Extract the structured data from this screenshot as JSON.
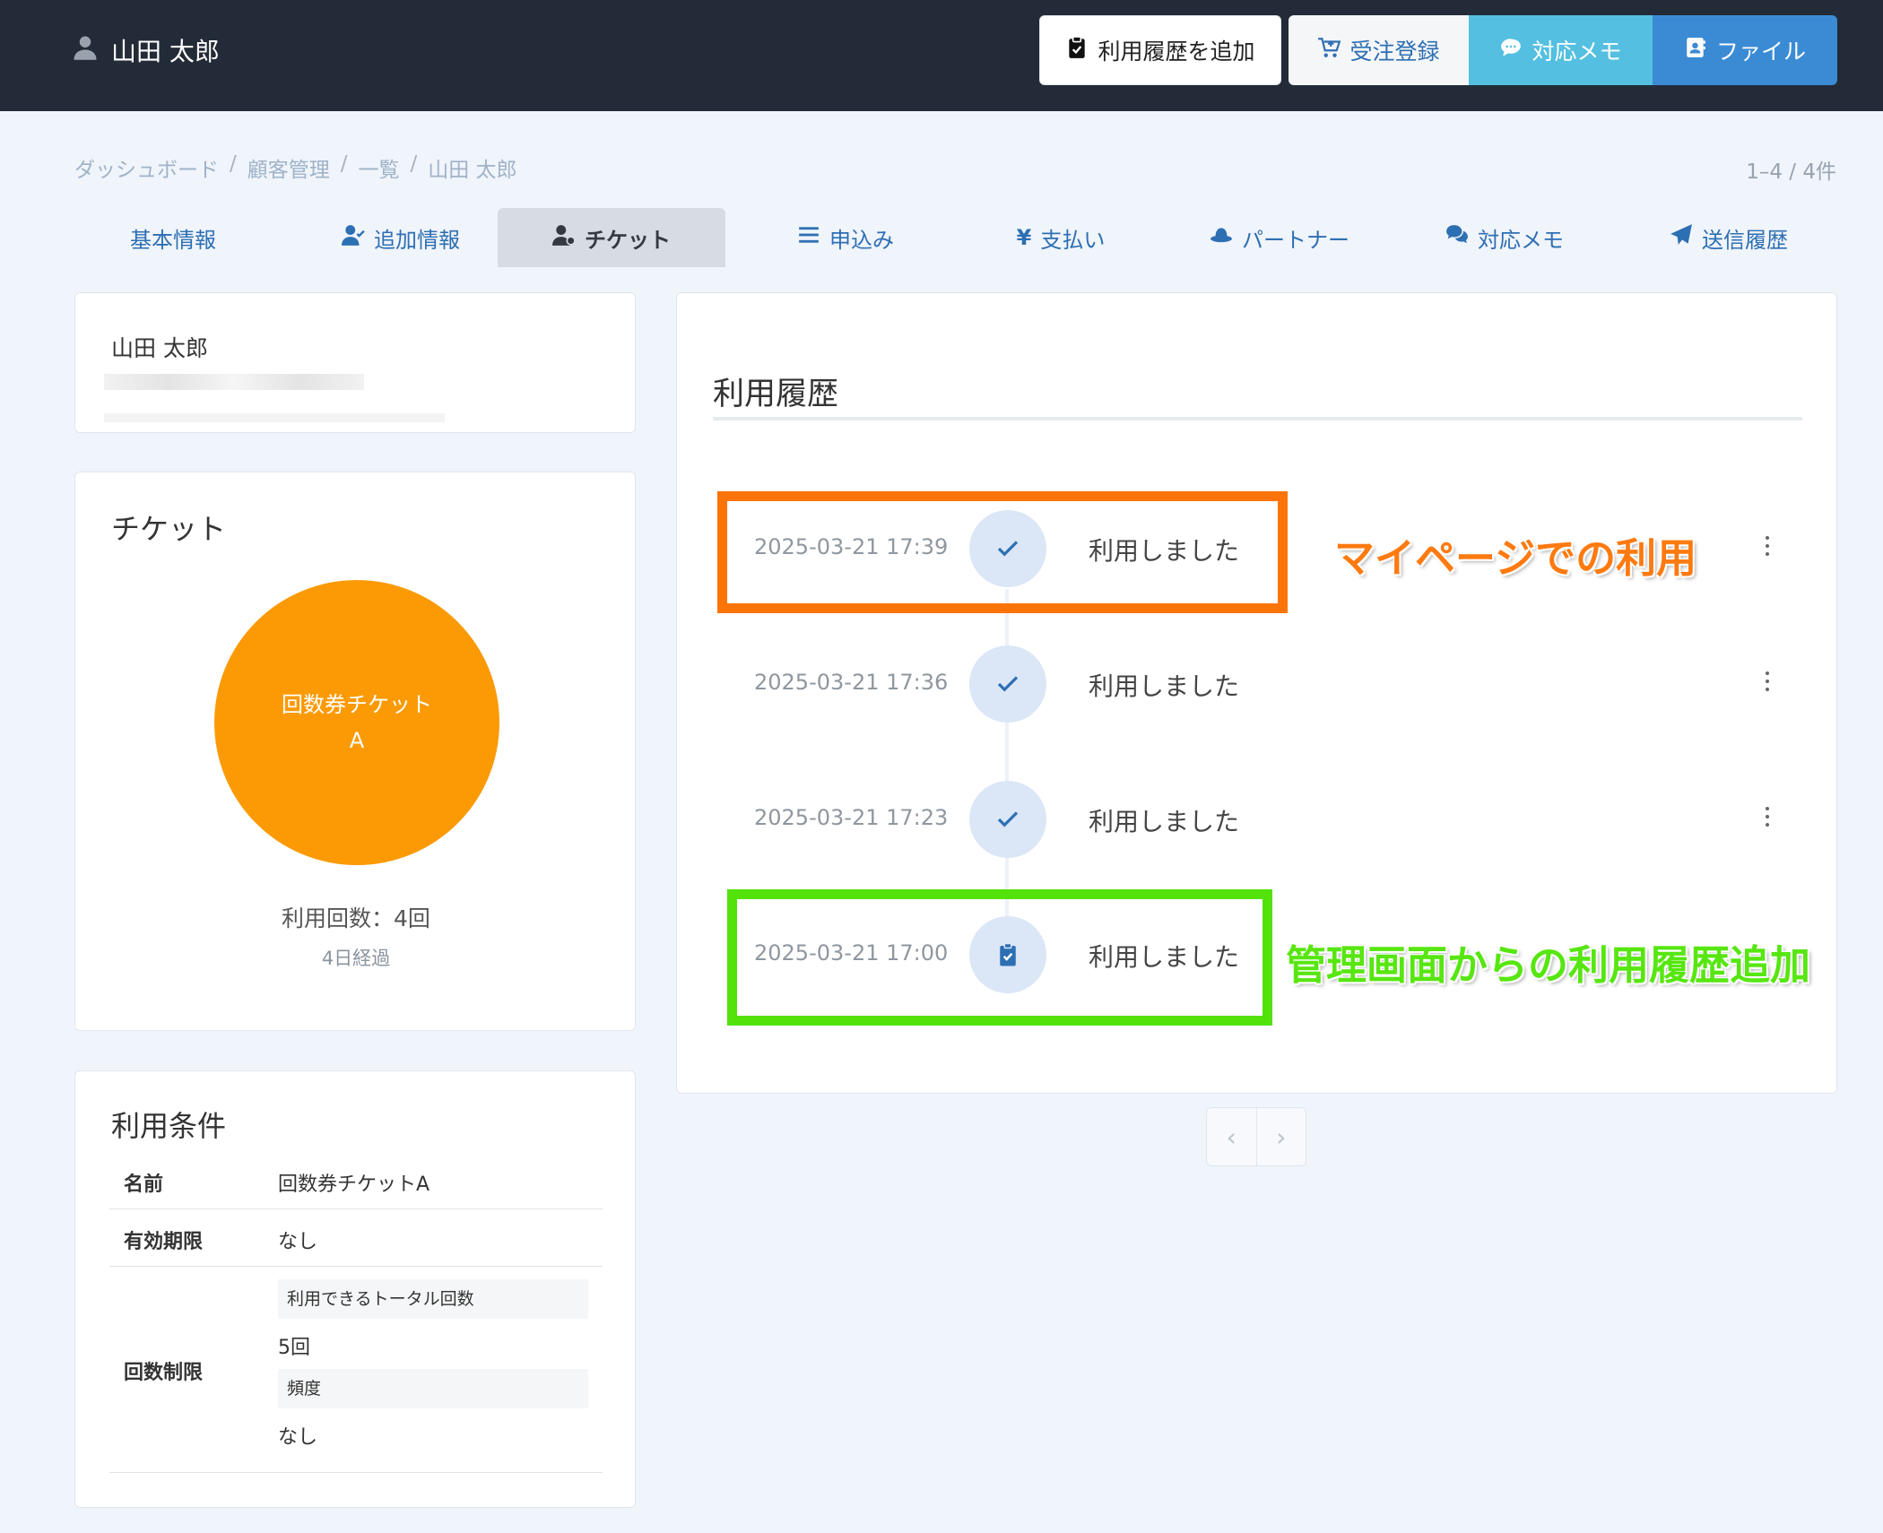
{
  "header": {
    "user_name": "山田 太郎",
    "buttons": {
      "add_history": "利用履歴を追加",
      "order": "受注登録",
      "memo": "対応メモ",
      "file": "ファイル"
    }
  },
  "breadcrumb": [
    "ダッシュボード",
    "顧客管理",
    "一覧",
    "山田 太郎"
  ],
  "record_count": "1–4 / 4件",
  "tabs": [
    {
      "label": "基本情報",
      "icon": "none"
    },
    {
      "label": "追加情報",
      "icon": "user-check-icon"
    },
    {
      "label": "チケット",
      "icon": "user-ticket-icon",
      "active": true
    },
    {
      "label": "申込み",
      "icon": "list-icon"
    },
    {
      "label": "支払い",
      "icon": "yen-icon"
    },
    {
      "label": "パートナー",
      "icon": "hat-icon"
    },
    {
      "label": "対応メモ",
      "icon": "comments-icon"
    },
    {
      "label": "送信履歴",
      "icon": "paper-plane-icon"
    }
  ],
  "customer": {
    "name": "山田 太郎"
  },
  "ticket": {
    "title": "チケット",
    "name": "回数券チケットA",
    "color": "#fb9a05",
    "usage_count": "利用回数：4回",
    "elapsed": "4日経過"
  },
  "conditions": {
    "title": "利用条件",
    "name_label": "名前",
    "name_value": "回数券チケットA",
    "expiry_label": "有効期限",
    "expiry_value": "なし",
    "limit_label": "回数制限",
    "total_label": "利用できるトータル回数",
    "total_value": "5回",
    "frequency_label": "頻度",
    "frequency_value": "なし"
  },
  "history": {
    "title": "利用履歴",
    "entries": [
      {
        "time": "2025-03-21 17:39",
        "label": "利用しました",
        "icon": "check-icon"
      },
      {
        "time": "2025-03-21 17:36",
        "label": "利用しました",
        "icon": "check-icon"
      },
      {
        "time": "2025-03-21 17:23",
        "label": "利用しました",
        "icon": "check-icon"
      },
      {
        "time": "2025-03-21 17:00",
        "label": "利用しました",
        "icon": "clipboard-check-icon"
      }
    ]
  },
  "annotations": {
    "mypage": "マイページでの利用",
    "admin": "管理画面からの利用履歴追加",
    "mypage_color": "#fd7406",
    "admin_color": "#54e20b"
  },
  "pager": {
    "prev": "‹",
    "next": "›"
  }
}
